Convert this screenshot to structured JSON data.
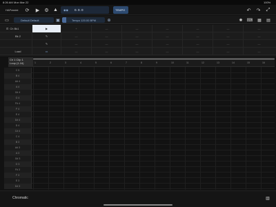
{
  "status_bar": {
    "time": "8:26 AM",
    "date": "Mon Mar 22",
    "battery": "100%"
  },
  "toolbar": {
    "app_name": "HAPassist",
    "position": "0. 0. 0",
    "tempo_button": "TEMPO",
    "icons": [
      "refresh-icon",
      "play-icon",
      "gear-icon",
      "metronome-icon",
      "undo-icon",
      "redo-icon",
      "expand-icon"
    ]
  },
  "secondary_bar": {
    "preset": "Default Default",
    "tempo": "Tempo 120.00 BPM"
  },
  "tracks": [
    {
      "label": "Ch Bk1",
      "cells": [
        "+",
        "—",
        "—",
        "—",
        "—",
        "—",
        "—",
        "—"
      ]
    },
    {
      "label": "Bk 2",
      "cells": [
        "—",
        "—",
        "—",
        "—",
        "—",
        "—",
        "—",
        "—"
      ]
    },
    {
      "label": "Load",
      "cells": [
        "—",
        "—",
        "—",
        "—",
        "—",
        "—",
        "—",
        "—"
      ]
    }
  ],
  "clip_info": {
    "line1": "Ch 1 Clip 1",
    "line2": "Loop (1.16)"
  },
  "ruler_ticks": [
    "1",
    "2",
    "3",
    "4",
    "5",
    "6",
    "7",
    "8",
    "9",
    "10",
    "11",
    "12",
    "13",
    "14",
    "15",
    "16"
  ],
  "note_rows": [
    "C 5",
    "B 4",
    "A# 4",
    "A 4",
    "G# 4",
    "G 4",
    "F# 4",
    "F 4",
    "E 4",
    "D# 4",
    "D 4",
    "C# 4",
    "C 4",
    "B 3",
    "A# 3",
    "A 3",
    "G# 3",
    "G 3",
    "F# 3",
    "F 3",
    "E 3",
    "D# 3"
  ],
  "bottom_bar": {
    "scale": "Chromatic"
  }
}
